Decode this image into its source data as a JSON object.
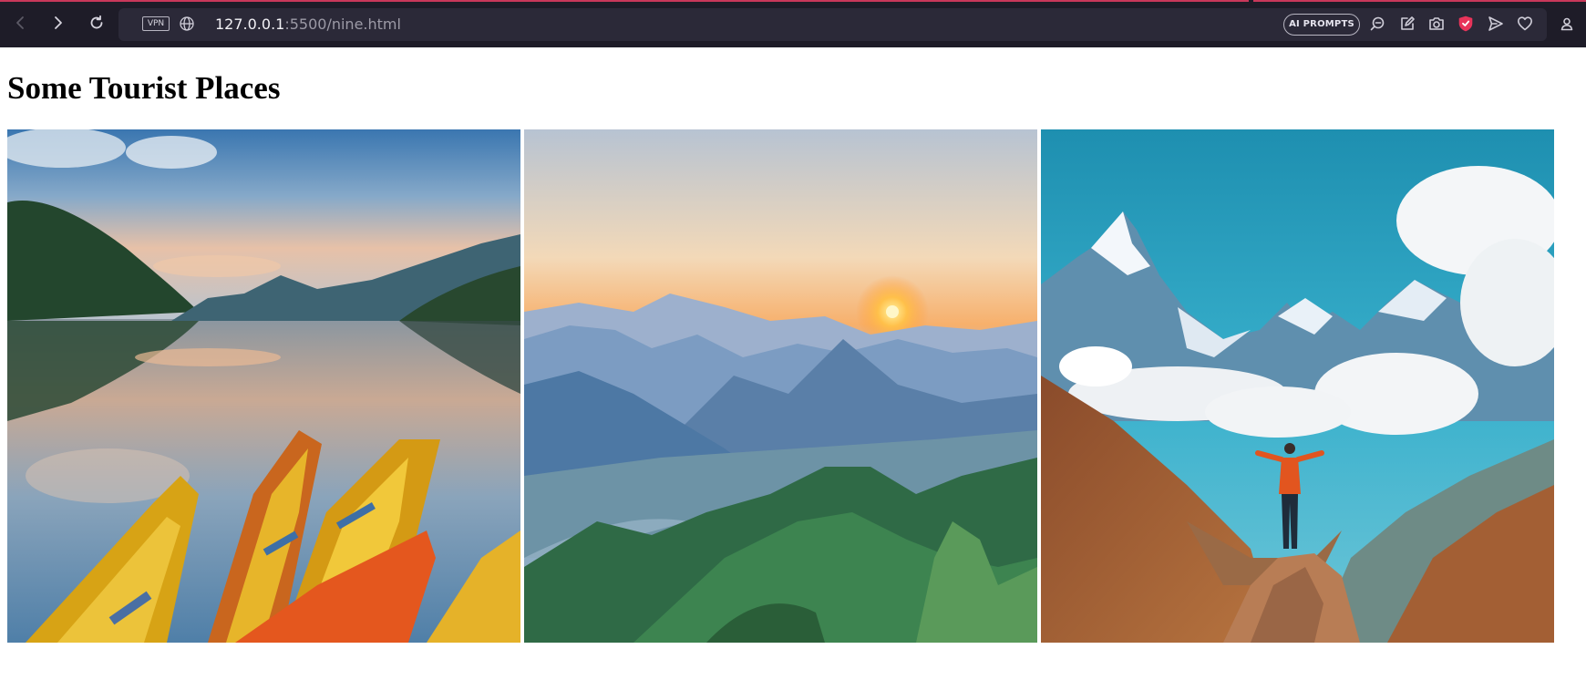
{
  "browser": {
    "vpn_label": "VPN",
    "url_host": "127.0.0.1",
    "url_rest": ":5500/nine.html",
    "ai_prompts_label": "AI PROMPTS",
    "toolbar_icons": [
      "back-icon",
      "forward-icon",
      "reload-icon",
      "globe-icon",
      "search-chat-icon",
      "edit-icon",
      "camera-icon",
      "shield-icon",
      "send-icon",
      "heart-icon",
      "profile-icon"
    ],
    "accent_color": "#c9385a"
  },
  "page": {
    "title": "Some Tourist Places",
    "images": [
      {
        "subject": "lake-with-boats"
      },
      {
        "subject": "mountain-sunrise-valley"
      },
      {
        "subject": "hiker-himalaya"
      }
    ]
  }
}
